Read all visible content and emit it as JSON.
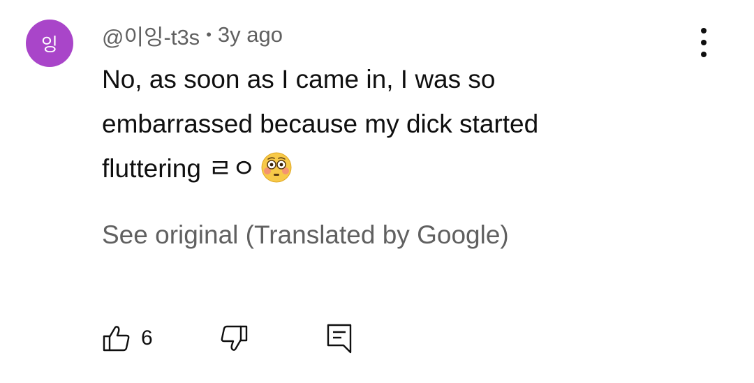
{
  "comment": {
    "avatar_initial": "잉",
    "avatar_color": "#a945c9",
    "author": "@이잉-t3s",
    "separator": "•",
    "timestamp": "3y ago",
    "text_lines": [
      "No, as soon as I came in, I was so",
      "embarrassed because my dick started",
      "fluttering ㄹㅇ"
    ],
    "emoji_icon": "flushed-face-emoji",
    "see_original": "See original (Translated by Google)",
    "actions": {
      "like_icon": "thumbs-up-icon",
      "like_count": "6",
      "dislike_icon": "thumbs-down-icon",
      "reply_icon": "reply-comment-icon"
    },
    "menu_icon": "more-vertical-icon"
  }
}
